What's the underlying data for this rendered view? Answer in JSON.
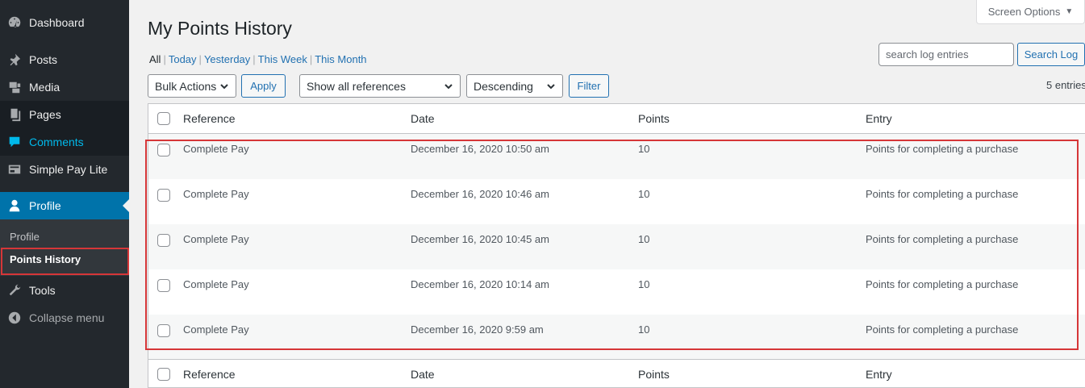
{
  "sidebar": {
    "items": [
      {
        "label": "Dashboard",
        "icon": "dashboard-icon"
      },
      {
        "label": "Posts",
        "icon": "pin-icon"
      },
      {
        "label": "Media",
        "icon": "media-icon"
      },
      {
        "label": "Pages",
        "icon": "pages-icon"
      },
      {
        "label": "Comments",
        "icon": "comments-icon"
      },
      {
        "label": "Simple Pay Lite",
        "icon": "card-icon"
      },
      {
        "label": "Profile",
        "icon": "user-icon"
      },
      {
        "label": "Tools",
        "icon": "wrench-icon"
      },
      {
        "label": "Collapse menu",
        "icon": "collapse-icon"
      }
    ],
    "submenu": [
      "Profile",
      "Points History"
    ]
  },
  "header": {
    "screen_options": "Screen Options",
    "title": "My Points History"
  },
  "views": {
    "all": "All",
    "today": "Today",
    "yesterday": "Yesterday",
    "this_week": "This Week",
    "this_month": "This Month"
  },
  "search": {
    "placeholder": "search log entries",
    "button": "Search Log"
  },
  "toolbar": {
    "bulk_actions": "Bulk Actions",
    "apply": "Apply",
    "references": "Show all references",
    "order": "Descending",
    "filter": "Filter",
    "entries": "5 entries"
  },
  "table": {
    "columns": [
      "Reference",
      "Date",
      "Points",
      "Entry"
    ],
    "rows": [
      {
        "reference": "Complete Pay",
        "date": "December 16, 2020 10:50 am",
        "points": "10",
        "entry": "Points for completing a purchase"
      },
      {
        "reference": "Complete Pay",
        "date": "December 16, 2020 10:46 am",
        "points": "10",
        "entry": "Points for completing a purchase"
      },
      {
        "reference": "Complete Pay",
        "date": "December 16, 2020 10:45 am",
        "points": "10",
        "entry": "Points for completing a purchase"
      },
      {
        "reference": "Complete Pay",
        "date": "December 16, 2020 10:14 am",
        "points": "10",
        "entry": "Points for completing a purchase"
      },
      {
        "reference": "Complete Pay",
        "date": "December 16, 2020 9:59 am",
        "points": "10",
        "entry": "Points for completing a purchase"
      }
    ]
  },
  "colors": {
    "sidebar_bg": "#23282d",
    "active_bg": "#0073aa",
    "link": "#2271b1",
    "highlight": "#d63638"
  }
}
